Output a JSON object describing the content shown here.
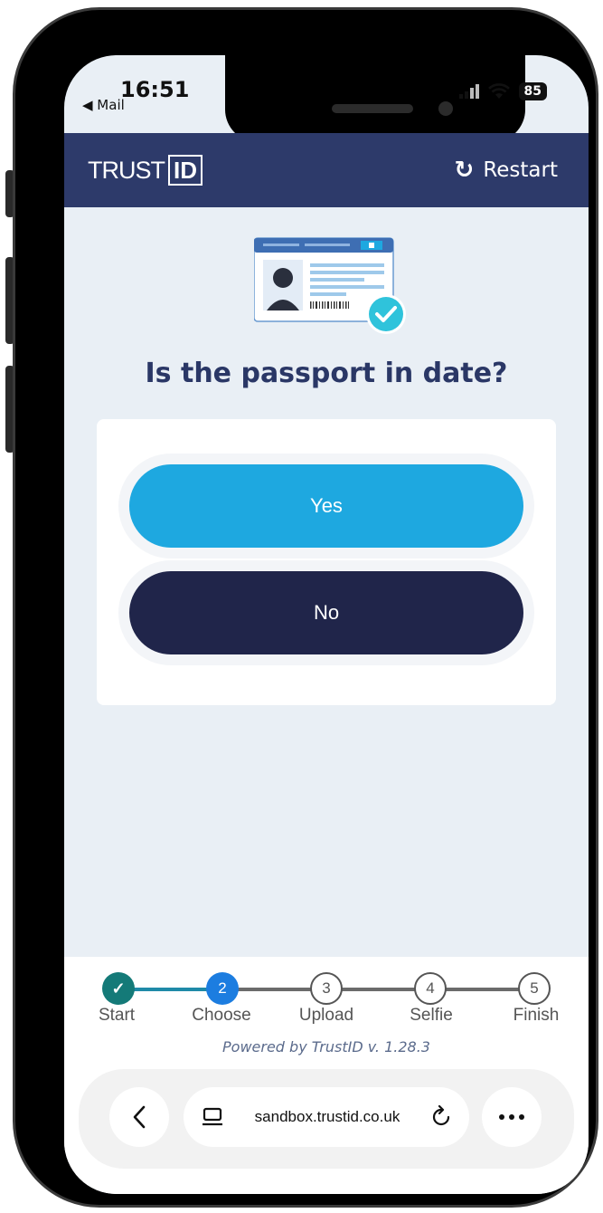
{
  "status_bar": {
    "time": "16:51",
    "back_app": "◀ Mail",
    "battery": "85"
  },
  "header": {
    "logo_text": "TRUST",
    "logo_box": "ID",
    "restart_label": "Restart"
  },
  "main": {
    "question": "Is the passport in date?",
    "yes_label": "Yes",
    "no_label": "No"
  },
  "progress": {
    "current_step": 2,
    "steps": [
      {
        "number": "✓",
        "label": "Start",
        "state": "done"
      },
      {
        "number": "2",
        "label": "Choose",
        "state": "active"
      },
      {
        "number": "3",
        "label": "Upload",
        "state": "todo"
      },
      {
        "number": "4",
        "label": "Selfie",
        "state": "todo"
      },
      {
        "number": "5",
        "label": "Finish",
        "state": "todo"
      }
    ]
  },
  "powered_by": "Powered by TrustID v. 1.28.3",
  "browser": {
    "url": "sandbox.trustid.co.uk"
  },
  "colors": {
    "header": "#2d3a6a",
    "yes_button": "#1ea8e0",
    "no_button": "#20254a",
    "step_done": "#147a78",
    "step_active": "#1c7de0"
  },
  "icons": {
    "restart": "restart-icon",
    "back": "chevron-left-icon",
    "tabs": "tab-overview-icon",
    "reload": "reload-icon",
    "more": "more-icon"
  }
}
